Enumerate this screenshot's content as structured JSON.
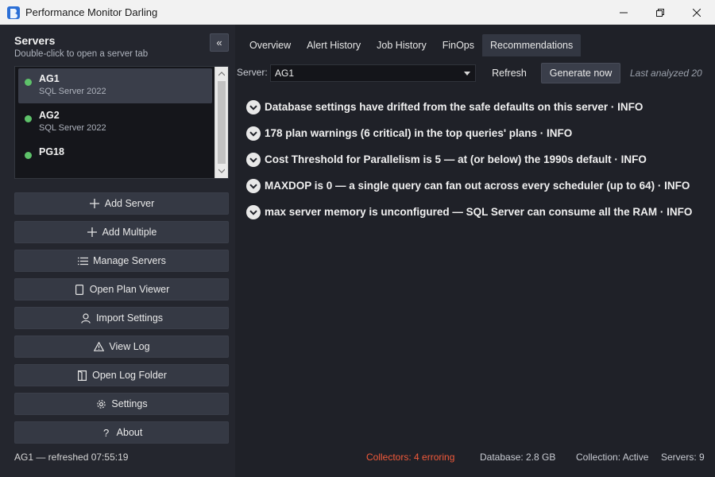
{
  "window": {
    "title": "Performance Monitor Darling",
    "icons": {
      "app": "pmd-logo-icon",
      "minimize": "minimize-icon",
      "restore": "restore-icon",
      "close": "close-icon"
    }
  },
  "sidebar": {
    "title": "Servers",
    "subtitle": "Double-click to open a server tab",
    "collapse_label": "«",
    "servers": [
      {
        "name": "AG1",
        "version": "SQL Server 2022",
        "status_color": "#5ec26a",
        "selected": true
      },
      {
        "name": "AG2",
        "version": "SQL Server 2022",
        "status_color": "#5ec26a",
        "selected": false
      },
      {
        "name": "PG18",
        "version": "",
        "status_color": "#5ec26a",
        "selected": false
      }
    ],
    "buttons": [
      {
        "label": "Add Server",
        "icon": "plus-icon"
      },
      {
        "label": "Add Multiple",
        "icon": "plus-icon"
      },
      {
        "label": "Manage Servers",
        "icon": "list-icon"
      },
      {
        "label": "Open Plan Viewer",
        "icon": "document-icon"
      },
      {
        "label": "Import Settings",
        "icon": "user-icon"
      },
      {
        "label": "View Log",
        "icon": "warning-icon"
      },
      {
        "label": "Open Log Folder",
        "icon": "folder-icon"
      },
      {
        "label": "Settings",
        "icon": "gear-icon"
      },
      {
        "label": "About",
        "icon": "question-icon"
      }
    ],
    "status": "AG1 — refreshed 07:55:19"
  },
  "main": {
    "tabs": [
      {
        "label": "Overview",
        "active": false
      },
      {
        "label": "Alert History",
        "active": false
      },
      {
        "label": "Job History",
        "active": false
      },
      {
        "label": "FinOps",
        "active": false
      },
      {
        "label": "Recommendations",
        "active": true
      }
    ],
    "toolbar": {
      "server_label": "Server:",
      "server_value": "AG1",
      "refresh_label": "Refresh",
      "generate_label": "Generate now",
      "last_analyzed": "Last analyzed 20"
    },
    "recommendations": [
      "Database settings have drifted from the safe defaults on this server · INFO",
      "178 plan warnings (6 critical) in the top queries' plans · INFO",
      "Cost Threshold for Parallelism is 5 — at (or below) the 1990s default · INFO",
      "MAXDOP is 0 — a single query can fan out across every scheduler (up to 64) · INFO",
      "max server memory is unconfigured — SQL Server can consume all the RAM · INFO"
    ]
  },
  "statusbar": {
    "collectors": "Collectors: 4 erroring",
    "collectors_color": "#f25a3a",
    "database": "Database: 2.8 GB",
    "collection": "Collection: Active",
    "servers": "Servers: 9"
  }
}
